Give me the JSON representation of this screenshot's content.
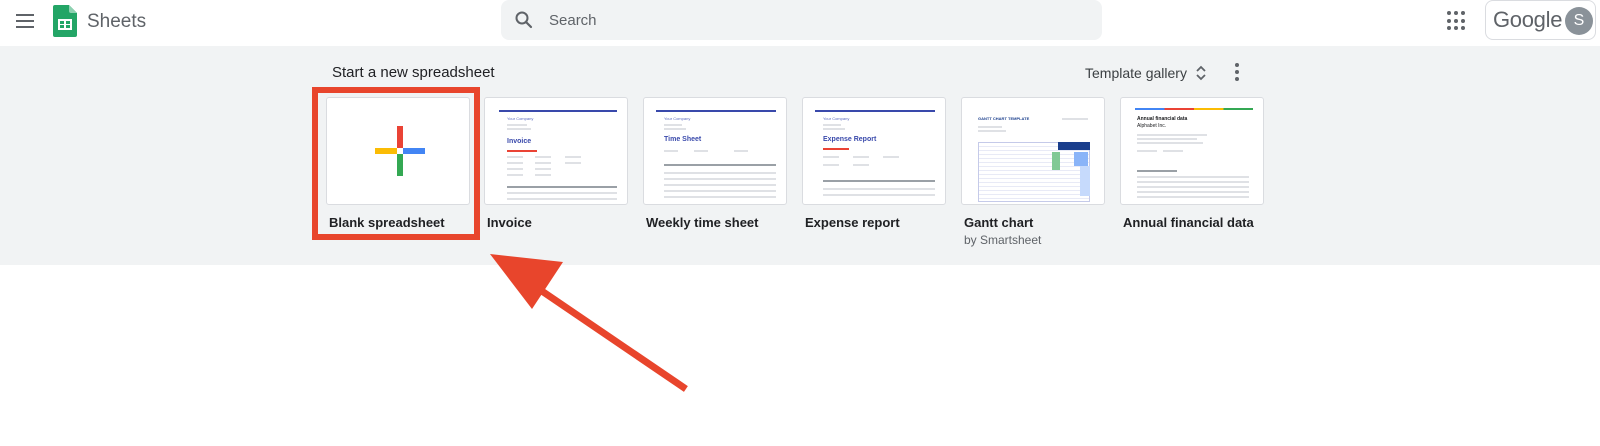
{
  "header": {
    "app_name": "Sheets",
    "search_placeholder": "Search",
    "brand_word": "Google",
    "avatar_initial": "S"
  },
  "start_section": {
    "title": "Start a new spreadsheet",
    "gallery_label": "Template gallery"
  },
  "templates": [
    {
      "name": "Blank spreadsheet",
      "subtitle": ""
    },
    {
      "name": "Invoice",
      "subtitle": "",
      "thumb_company": "Your Company",
      "thumb_title": "Invoice"
    },
    {
      "name": "Weekly time sheet",
      "subtitle": "",
      "thumb_company": "Your Company",
      "thumb_title": "Time Sheet"
    },
    {
      "name": "Expense report",
      "subtitle": "",
      "thumb_company": "Your Company",
      "thumb_title": "Expense Report"
    },
    {
      "name": "Gantt chart",
      "subtitle": "by Smartsheet",
      "thumb_title": "GANTT CHART TEMPLATE"
    },
    {
      "name": "Annual financial data",
      "subtitle": "",
      "thumb_title": "Annual financial data",
      "thumb_company": "Alphabet Inc."
    }
  ],
  "colors": {
    "highlight": "#e8452c",
    "band": "#f1f3f4",
    "plus_red": "#ea4335",
    "plus_yellow": "#fbbc04",
    "plus_green": "#34a853",
    "plus_blue": "#4285f4"
  },
  "icons": [
    "menu-icon",
    "sheets-logo-icon",
    "search-icon",
    "apps-grid-icon",
    "unfold-icon",
    "more-vert-icon",
    "plus-icon"
  ]
}
